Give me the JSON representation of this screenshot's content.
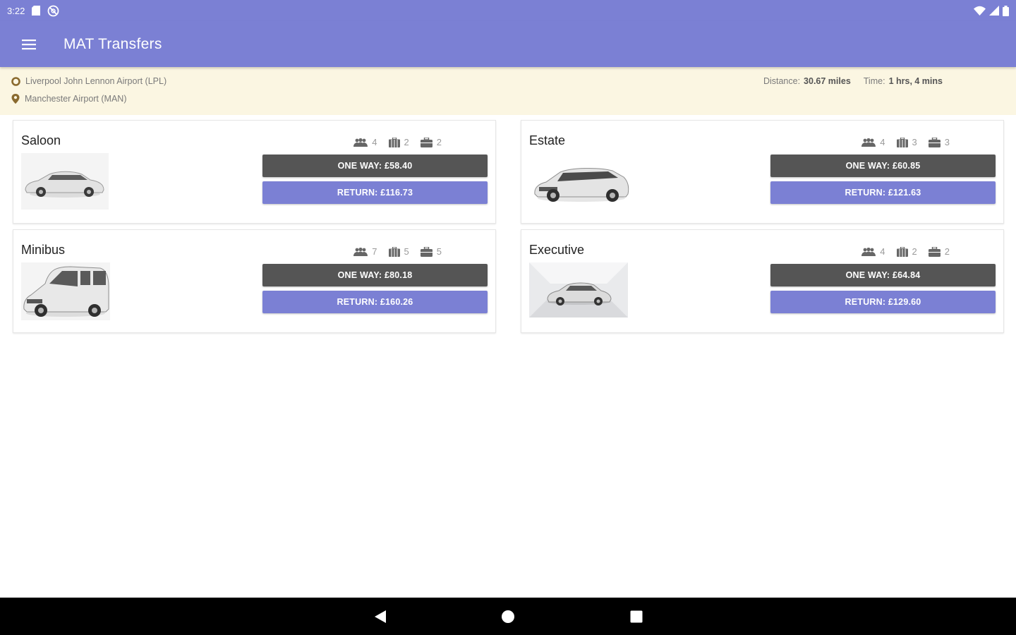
{
  "status_bar": {
    "time": "3:22",
    "icons_left": [
      "sd-card-icon",
      "sync-disabled-icon"
    ],
    "icons_right": [
      "wifi-icon",
      "cell-signal-icon",
      "battery-icon"
    ]
  },
  "app_bar": {
    "title": "MAT Transfers",
    "menu_icon": "hamburger-menu-icon",
    "color": "#7b80d4"
  },
  "route": {
    "pickup": "Liverpool John Lennon Airport (LPL)",
    "dropoff": "Manchester Airport (MAN)",
    "distance_label": "Distance:",
    "distance_value": "30.67 miles",
    "time_label": "Time:",
    "time_value": "1 hrs, 4 mins",
    "background": "#fbf6e2"
  },
  "vehicles": [
    {
      "name": "Saloon",
      "passengers": "4",
      "large_bags": "2",
      "small_bags": "2",
      "one_way": "ONE WAY: £58.40",
      "return": "RETURN: £116.73"
    },
    {
      "name": "Estate",
      "passengers": "4",
      "large_bags": "3",
      "small_bags": "3",
      "one_way": "ONE WAY: £60.85",
      "return": "RETURN: £121.63"
    },
    {
      "name": "Minibus",
      "passengers": "7",
      "large_bags": "5",
      "small_bags": "5",
      "one_way": "ONE WAY: £80.18",
      "return": "RETURN: £160.26"
    },
    {
      "name": "Executive",
      "passengers": "4",
      "large_bags": "2",
      "small_bags": "2",
      "one_way": "ONE WAY: £64.84",
      "return": "RETURN: £129.60"
    }
  ],
  "colors": {
    "one_way_button": "#555555",
    "return_button": "#7b80d4"
  },
  "nav_bar": {
    "icons": [
      "back-icon",
      "home-icon",
      "recents-icon"
    ]
  }
}
